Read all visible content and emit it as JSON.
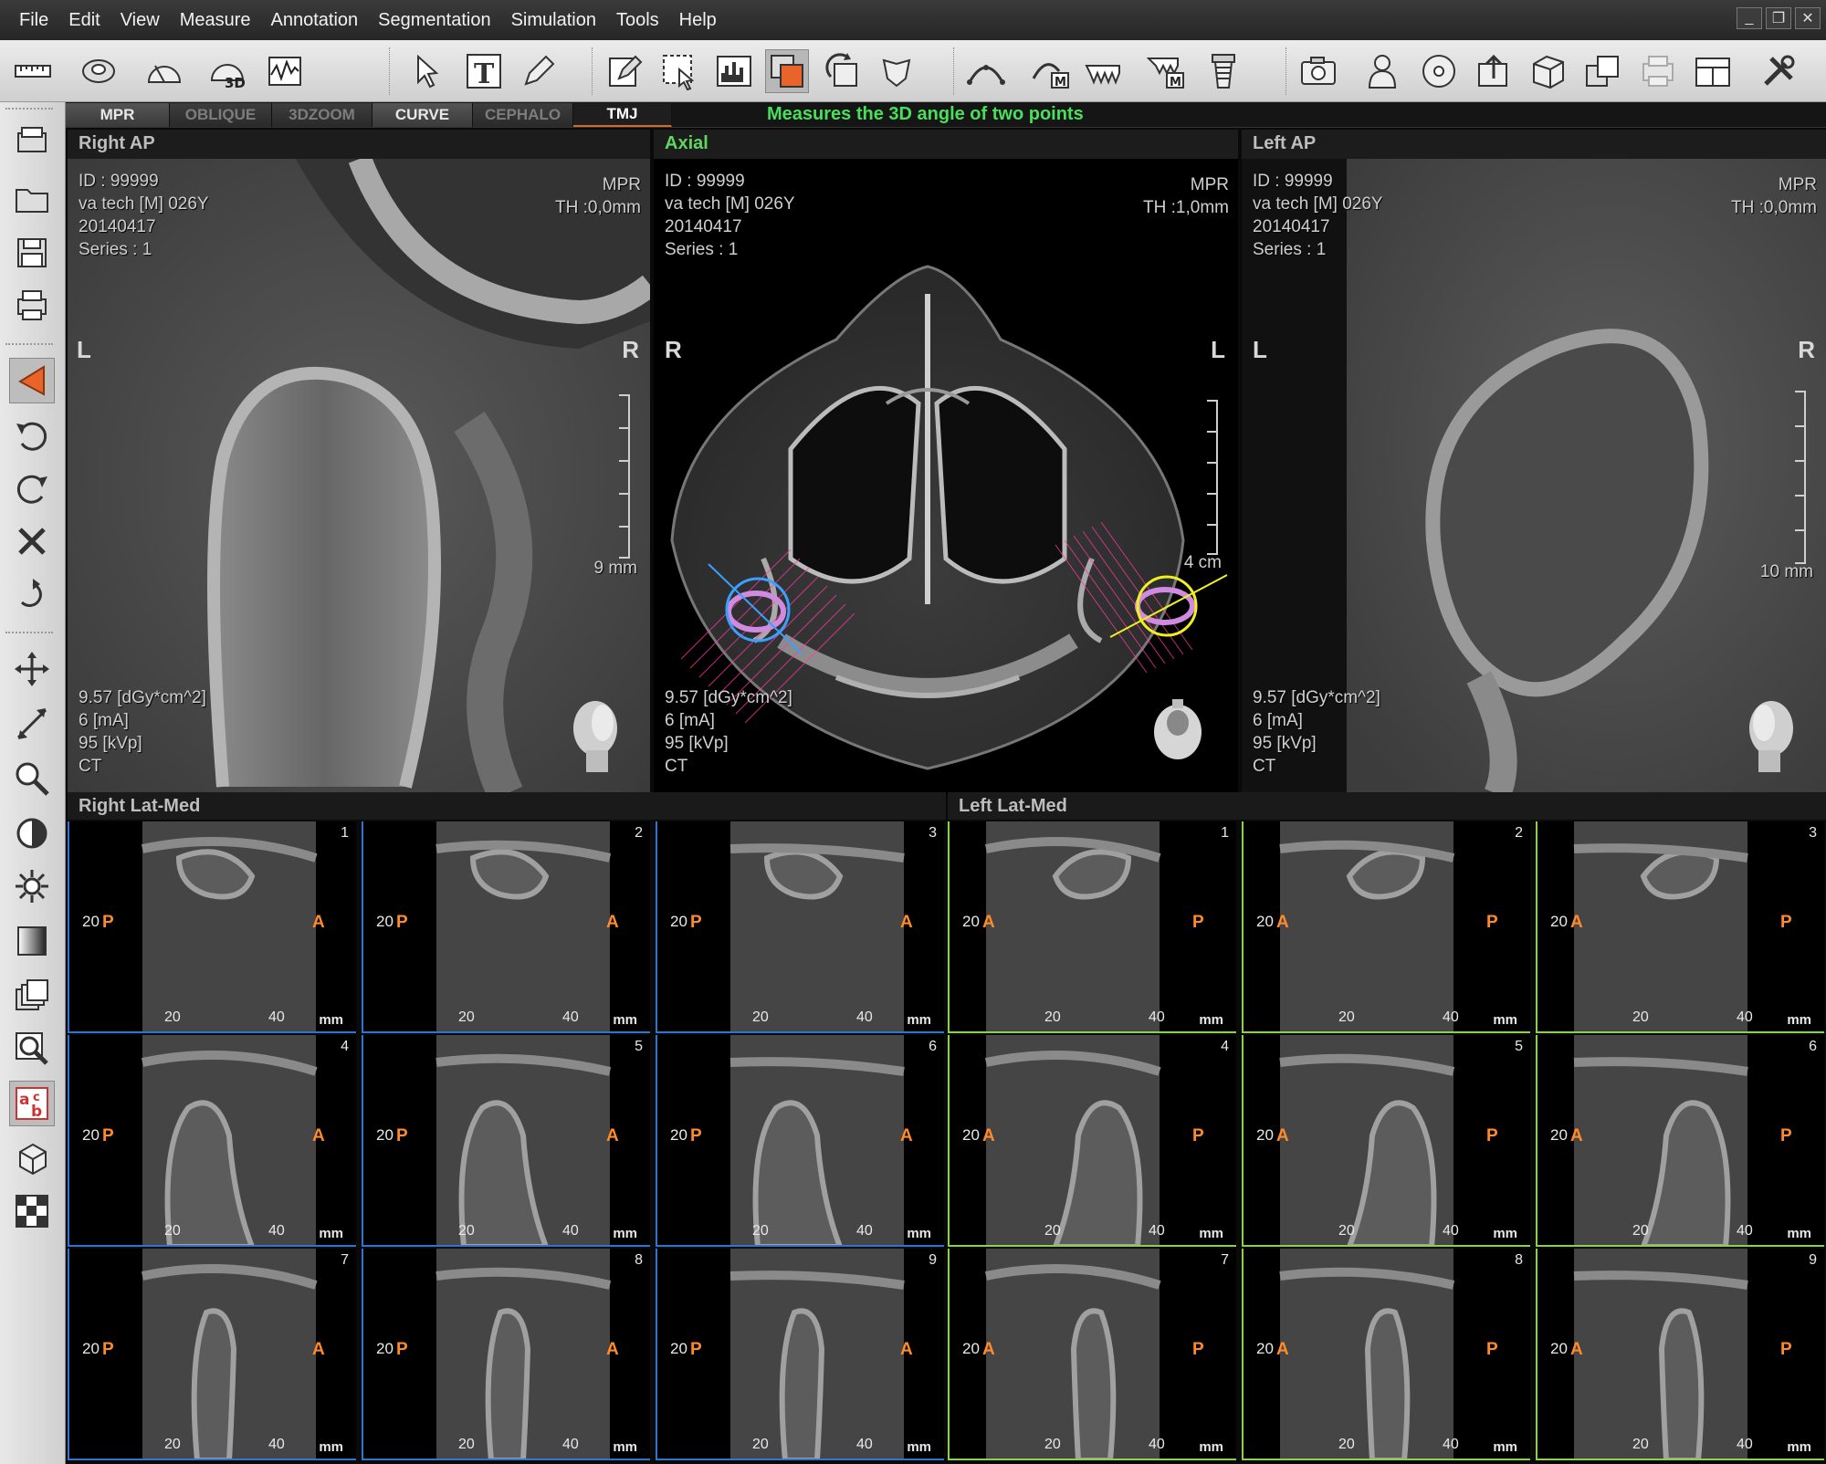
{
  "menu": [
    "File",
    "Edit",
    "View",
    "Measure",
    "Annotation",
    "Segmentation",
    "Simulation",
    "Tools",
    "Help"
  ],
  "window_controls": [
    "_",
    "❐",
    "✕"
  ],
  "tabs": [
    "MPR",
    "OBLIQUE",
    "3DZOOM",
    "CURVE",
    "CEPHALO",
    "TMJ"
  ],
  "active_tab": "TMJ",
  "hint": "Measures the 3D angle of two  points",
  "viewports": {
    "right_ap": {
      "title": "Right AP",
      "info": [
        "ID : 99999",
        "va tech  [M] 026Y",
        "20140417",
        "Series : 1"
      ],
      "mode": "MPR",
      "th": "TH :0,0mm",
      "left_orient": "L",
      "right_orient": "R",
      "scale": "9 mm",
      "dose": [
        "9.57  [dGy*cm^2]",
        "6  [mA]",
        "95  [kVp]",
        "CT"
      ]
    },
    "axial": {
      "title": "Axial",
      "info": [
        "ID : 99999",
        "va tech  [M] 026Y",
        "20140417",
        "Series : 1"
      ],
      "mode": "MPR",
      "th": "TH :1,0mm",
      "left_orient": "R",
      "right_orient": "L",
      "scale": "4 cm",
      "dose": [
        "9.57  [dGy*cm^2]",
        "6  [mA]",
        "95  [kVp]",
        "CT"
      ]
    },
    "left_ap": {
      "title": "Left AP",
      "info": [
        "ID : 99999",
        "va tech  [M] 026Y",
        "20140417",
        "Series : 1"
      ],
      "mode": "MPR",
      "th": "TH :0,0mm",
      "left_orient": "L",
      "right_orient": "R",
      "scale": "10 mm",
      "dose": [
        "9.57  [dGy*cm^2]",
        "6  [mA]",
        "95  [kVp]",
        "CT"
      ]
    }
  },
  "right_latmed": {
    "title": "Right Lat-Med",
    "cells": [
      {
        "num": "1",
        "depth": "20",
        "left": "P",
        "right": "A",
        "t1": "20",
        "t2": "40",
        "unit": "mm"
      },
      {
        "num": "2",
        "depth": "20",
        "left": "P",
        "right": "A",
        "t1": "20",
        "t2": "40",
        "unit": "mm"
      },
      {
        "num": "3",
        "depth": "20",
        "left": "P",
        "right": "A",
        "t1": "20",
        "t2": "40",
        "unit": "mm"
      },
      {
        "num": "4",
        "depth": "20",
        "left": "P",
        "right": "A",
        "t1": "20",
        "t2": "40",
        "unit": "mm"
      },
      {
        "num": "5",
        "depth": "20",
        "left": "P",
        "right": "A",
        "t1": "20",
        "t2": "40",
        "unit": "mm"
      },
      {
        "num": "6",
        "depth": "20",
        "left": "P",
        "right": "A",
        "t1": "20",
        "t2": "40",
        "unit": "mm"
      },
      {
        "num": "7",
        "depth": "20",
        "left": "P",
        "right": "A",
        "t1": "20",
        "t2": "40",
        "unit": "mm"
      },
      {
        "num": "8",
        "depth": "20",
        "left": "P",
        "right": "A",
        "t1": "20",
        "t2": "40",
        "unit": "mm"
      },
      {
        "num": "9",
        "depth": "20",
        "left": "P",
        "right": "A",
        "t1": "20",
        "t2": "40",
        "unit": "mm"
      }
    ]
  },
  "left_latmed": {
    "title": "Left Lat-Med",
    "cells": [
      {
        "num": "1",
        "depth": "20",
        "left": "A",
        "right": "P",
        "t1": "20",
        "t2": "40",
        "unit": "mm"
      },
      {
        "num": "2",
        "depth": "20",
        "left": "A",
        "right": "P",
        "t1": "20",
        "t2": "40",
        "unit": "mm"
      },
      {
        "num": "3",
        "depth": "20",
        "left": "A",
        "right": "P",
        "t1": "20",
        "t2": "40",
        "unit": "mm"
      },
      {
        "num": "4",
        "depth": "20",
        "left": "A",
        "right": "P",
        "t1": "20",
        "t2": "40",
        "unit": "mm"
      },
      {
        "num": "5",
        "depth": "20",
        "left": "A",
        "right": "P",
        "t1": "20",
        "t2": "40",
        "unit": "mm"
      },
      {
        "num": "6",
        "depth": "20",
        "left": "A",
        "right": "P",
        "t1": "20",
        "t2": "40",
        "unit": "mm"
      },
      {
        "num": "7",
        "depth": "20",
        "left": "A",
        "right": "P",
        "t1": "20",
        "t2": "40",
        "unit": "mm"
      },
      {
        "num": "8",
        "depth": "20",
        "left": "A",
        "right": "P",
        "t1": "20",
        "t2": "40",
        "unit": "mm"
      },
      {
        "num": "9",
        "depth": "20",
        "left": "A",
        "right": "P",
        "t1": "20",
        "t2": "40",
        "unit": "mm"
      }
    ]
  },
  "toolbar_icons": [
    "ruler-icon",
    "tape-measure-icon",
    "angle-icon",
    "3d-angle-icon",
    "profile-icon",
    "pointer-icon",
    "text-icon",
    "pencil-icon",
    "edit-note-icon",
    "select-region-icon",
    "histogram-icon",
    "overlay-icon",
    "rotate-tool-icon",
    "implant-tool-icon",
    "arch-icon",
    "arch-measure-icon",
    "teeth-icon",
    "teeth-measure-icon",
    "implant-icon",
    "camera-icon",
    "user-icon",
    "disc-icon",
    "export-icon",
    "save-3d-icon",
    "layers-icon",
    "print-disabled-icon",
    "layout-icon",
    "settings-tools-icon"
  ],
  "left_icons": [
    "print-report-icon",
    "open-folder-icon",
    "save-icon",
    "printer-icon",
    "measure-angle-icon",
    "undo-icon",
    "redo-icon",
    "delete-icon",
    "rotate-icon",
    "pan-icon",
    "stretch-icon",
    "zoom-icon",
    "contrast-icon",
    "brightness-icon",
    "gradient-icon",
    "stack-icon",
    "magnify-icon",
    "label-icon",
    "cube-icon",
    "checker-icon"
  ],
  "accent_colors": {
    "active_tab_line": "#d26a2a",
    "hint_text": "#48e05a",
    "right_grid": "#2e74d0",
    "left_grid": "#8fd04a",
    "orientation_letter": "#ff8a2a"
  }
}
